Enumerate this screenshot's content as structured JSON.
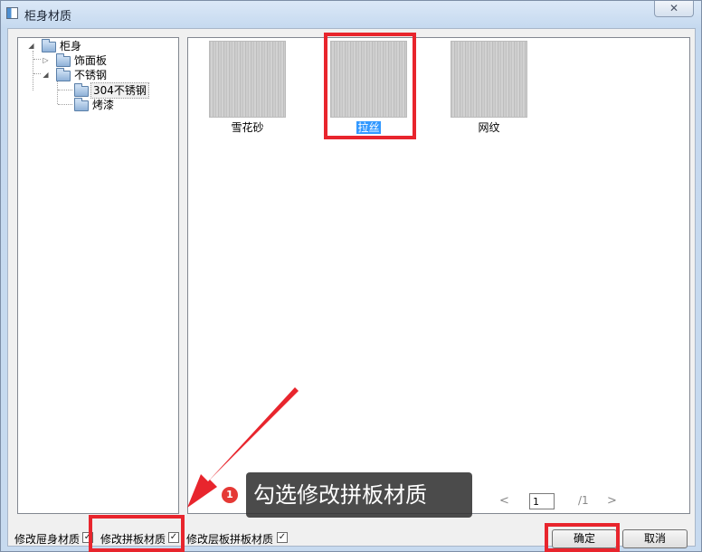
{
  "window": {
    "title": "柜身材质",
    "close_glyph": "✕"
  },
  "tree": {
    "root": "柜身",
    "children": [
      {
        "label": "饰面板"
      },
      {
        "label": "不锈钢",
        "children": [
          {
            "label": "304不锈钢"
          },
          {
            "label": "烤漆"
          }
        ]
      }
    ]
  },
  "gallery": {
    "items": [
      {
        "label": "雪花砂"
      },
      {
        "label": "拉丝"
      },
      {
        "label": "网纹"
      }
    ],
    "selected_index": 1
  },
  "pager": {
    "prev": "<",
    "current": "1",
    "total": "/1",
    "next": ">"
  },
  "options": {
    "cabinet_body": "修改屉身材质",
    "panel": "修改拼板材质",
    "shelf_panel": "修改层板拼板材质",
    "check_glyph": "✓"
  },
  "buttons": {
    "ok": "确定",
    "cancel": "取消"
  },
  "annotation": {
    "step": "1",
    "text": "勾选修改拼板材质"
  },
  "colors": {
    "highlight": "#e8252d",
    "selection": "#3399ff",
    "callout_bg": "#323232"
  }
}
